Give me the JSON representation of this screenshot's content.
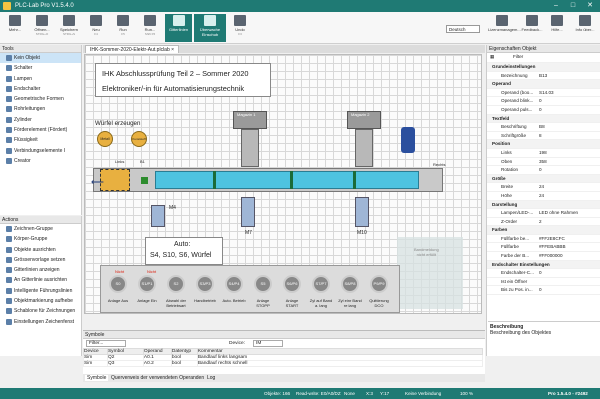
{
  "window": {
    "title": "PLC-Lab Pro V1.5.4.0"
  },
  "ribbon": {
    "buttons": [
      {
        "label": "Mehr...",
        "sub": ""
      },
      {
        "label": "Öffnen...",
        "sub": "STRG+O"
      },
      {
        "label": "Speichern",
        "sub": "STRG+S"
      },
      {
        "label": "Neu",
        "sub": "F4"
      },
      {
        "label": "Run",
        "sub": "F5"
      },
      {
        "label": "Run...",
        "sub": "Shift F5"
      },
      {
        "label": "Gitterlinien",
        "sub": ""
      },
      {
        "label": "Überwache Einschub",
        "sub": ""
      },
      {
        "label": "Undo",
        "sub": "F3"
      }
    ],
    "right": [
      "Lizenzmanagem...",
      "Feedback...",
      "Hilfe...",
      "Info über..."
    ],
    "language": "Deutsch"
  },
  "tools": {
    "header": "Tools",
    "items": [
      "Kein Objekt",
      "Schalter",
      "Lampen",
      "Endschalter",
      "Geometrische Formen",
      "Rohrleitungen",
      "Zylinder",
      "Förderelement (Fördert)",
      "Flüssigkeit",
      "Verbindungselemente I",
      "Creator"
    ]
  },
  "actions": {
    "header": "Actions",
    "items": [
      "Zeichnen-Gruppe",
      "Körper-Gruppe",
      "Objekte ausrichten",
      "Grössenvorlage setzen",
      "Gitterlinien anzeigen",
      "An Gitterlinie ausrichten",
      "Intelligente Führungslinien",
      "Objektmarkierung aufhebe",
      "Schablone für Zeichnungen",
      "Einstellungen Zeichenfenst"
    ]
  },
  "document": {
    "tab": "IHK-Sommer-2020-Elektr-Aut.plclab",
    "title1": "IHK Abschlussprüfung Teil 2 – Sommer 2020",
    "title2": "Elektroniker/-in für Automatisierungstechnik",
    "wuerfel": "Würfel erzeugen",
    "btn_metall": "Metall",
    "btn_kunststoff": "Kunststoff",
    "links": "Links",
    "rechts": "Rechts",
    "b1": "B1",
    "m4": "M4",
    "m7": "M7",
    "m10": "M10",
    "magazin1": "Magazin 1",
    "magazin2": "Magazin 2",
    "auto_line1": "Auto:",
    "auto_line2": "S4, S10, S6, Würfel",
    "bandmeldung": "Bandmeldung\nnicht erfüllt",
    "stations": [
      {
        "code": "S0",
        "label": "Anlage Aus"
      },
      {
        "code": "S1/P1",
        "label": "Anlage Ein"
      },
      {
        "code": "S2",
        "label": "Abwahl der Betriebsart"
      },
      {
        "code": "S3/P3",
        "label": "Handbetrieb"
      },
      {
        "code": "S4/P4",
        "label": "Auto. Betrieb"
      },
      {
        "code": "S5",
        "label": "Anlage STOPP"
      },
      {
        "code": "S6/P6",
        "label": "Anlage START"
      },
      {
        "code": "S7/P7",
        "label": "Zyl auf Band a. lang"
      },
      {
        "code": "S8/P8",
        "label": "Zyl einr Band re lang"
      },
      {
        "code": "P9/P9",
        "label": "Quittierung DCO"
      }
    ],
    "nicht1": "Nicht",
    "nicht2": "Nicht"
  },
  "props": {
    "header": "Eigenschaften Objekt",
    "filter": "Filter",
    "rows": [
      {
        "sec": true,
        "k": "Grundeinstellungen"
      },
      {
        "k": "Bezeichnung",
        "v": "B13"
      },
      {
        "sec": true,
        "k": "Operand"
      },
      {
        "k": "Operand (boo...",
        "v": "S14.03"
      },
      {
        "k": "Operand blink...",
        "v": "0"
      },
      {
        "k": "Operand puls...",
        "v": "0"
      },
      {
        "sec": true,
        "k": "Textfeld"
      },
      {
        "k": "Beschriftung",
        "v": "B8"
      },
      {
        "k": "Schriftgröße",
        "v": "8"
      },
      {
        "sec": true,
        "k": "Position"
      },
      {
        "k": "Links",
        "v": "198"
      },
      {
        "k": "Oben",
        "v": "358"
      },
      {
        "k": "Rotation",
        "v": "0"
      },
      {
        "sec": true,
        "k": "Größe"
      },
      {
        "k": "Breite",
        "v": "24"
      },
      {
        "k": "Höhe",
        "v": "24"
      },
      {
        "sec": true,
        "k": "Darstellung"
      },
      {
        "k": "Lampen/LED-...",
        "v": "LED ohne Rahmen"
      },
      {
        "k": "Z-Order",
        "v": "2"
      },
      {
        "sec": true,
        "k": "Farben"
      },
      {
        "k": "Füllfarbe be...",
        "v": "#FF2E8CFC"
      },
      {
        "k": "Füllfarbe",
        "v": "#FFEBABBB"
      },
      {
        "k": "Farbe der B...",
        "v": "#FF000000"
      },
      {
        "sec": true,
        "k": "Endschalter Einstellungen"
      },
      {
        "k": "Endschalter-C...",
        "v": "0"
      },
      {
        "k": "Ist ein Öffner",
        "v": ""
      },
      {
        "k": "Bis zu Pos. in...",
        "v": "0"
      }
    ],
    "desc_title": "Beschreibung",
    "desc_text": "Beschreibung des Objektes"
  },
  "symbole": {
    "header": "Symbole",
    "filter": "Filter...",
    "device_label": "Device:",
    "device_value": "IM",
    "columns": [
      "Device",
      "Symbol",
      "Operand",
      "Datentyp",
      "Kommentar"
    ],
    "rows": [
      [
        "Sim",
        "Q2",
        "A0.1",
        "bool",
        "Bandlauf links langsam"
      ],
      [
        "Sim",
        "Q3",
        "A0.2",
        "bool",
        "Bandlauf rechts schnell"
      ]
    ],
    "tabs": [
      "Symbole",
      "Querverweis der verwendeten Operanden",
      "Log"
    ]
  },
  "status": {
    "objekte": "Objekte: 166",
    "readwrite": "Read-write: E0/A0/DZ",
    "none": "None",
    "x": "X:3",
    "y": "Y:17",
    "verbindung": "Keine Verbindung",
    "zoom": "100 %",
    "version": "Pro 1.5.4.0 - #2492"
  },
  "colors": {
    "teal": "#1f7a74",
    "conveyor": "#4ec3e0",
    "amber": "#e8b040"
  }
}
